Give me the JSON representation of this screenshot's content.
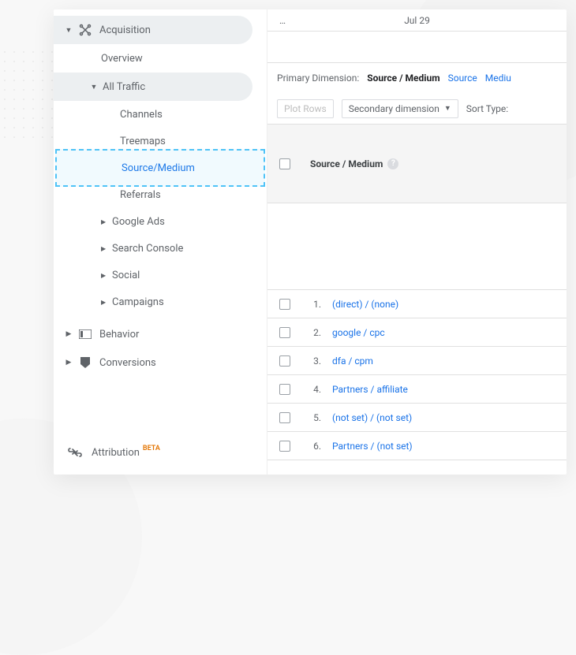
{
  "sidebar": {
    "acquisition": {
      "label": "Acquisition"
    },
    "overview": {
      "label": "Overview"
    },
    "all_traffic": {
      "label": "All Traffic"
    },
    "channels": {
      "label": "Channels"
    },
    "treemaps": {
      "label": "Treemaps"
    },
    "source_medium": {
      "label": "Source/Medium"
    },
    "referrals": {
      "label": "Referrals"
    },
    "google_ads": {
      "label": "Google Ads"
    },
    "search_console": {
      "label": "Search Console"
    },
    "social": {
      "label": "Social"
    },
    "campaigns": {
      "label": "Campaigns"
    },
    "behavior": {
      "label": "Behavior"
    },
    "conversions": {
      "label": "Conversions"
    },
    "attribution": {
      "label": "Attribution",
      "badge": "BETA"
    }
  },
  "main": {
    "date_ellipsis": "…",
    "date_center": "Jul 29",
    "primary_dimension_label": "Primary Dimension:",
    "pd_active": "Source / Medium",
    "pd_links": [
      "Source",
      "Mediu"
    ],
    "plot_rows": "Plot Rows",
    "secondary_dimension": "Secondary dimension",
    "sort_type": "Sort Type:",
    "column_header": "Source / Medium",
    "rows": [
      {
        "n": "1.",
        "v": "(direct) / (none)"
      },
      {
        "n": "2.",
        "v": "google / cpc"
      },
      {
        "n": "3.",
        "v": "dfa / cpm"
      },
      {
        "n": "4.",
        "v": "Partners / affiliate"
      },
      {
        "n": "5.",
        "v": "(not set) / (not set)"
      },
      {
        "n": "6.",
        "v": "Partners / (not set)"
      }
    ]
  }
}
